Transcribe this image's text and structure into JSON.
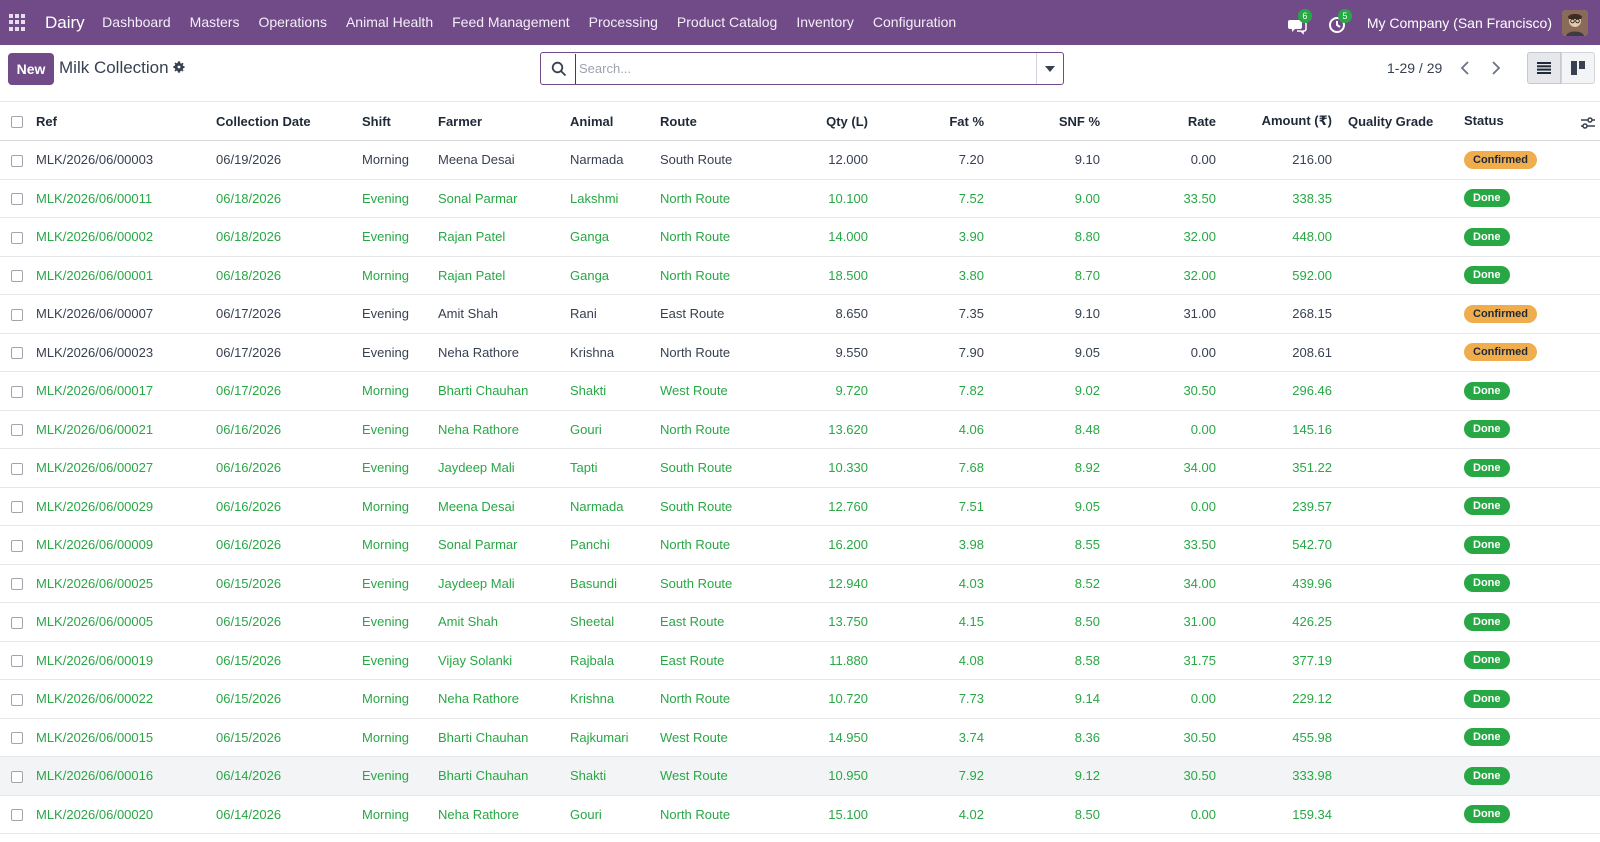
{
  "navbar": {
    "brand": "Dairy",
    "menu": [
      "Dashboard",
      "Masters",
      "Operations",
      "Animal Health",
      "Feed Management",
      "Processing",
      "Product Catalog",
      "Inventory",
      "Configuration"
    ],
    "messages_count": "6",
    "activities_count": "5",
    "company": "My Company (San Francisco)",
    "accent_color": "#714b88"
  },
  "control": {
    "new_label": "New",
    "title": "Milk Collection",
    "search_placeholder": "Search...",
    "pager": "1-29 / 29"
  },
  "table": {
    "headers": {
      "ref": "Ref",
      "date": "Collection Date",
      "shift": "Shift",
      "farmer": "Farmer",
      "animal": "Animal",
      "route": "Route",
      "qty": "Qty (L)",
      "fat": "Fat %",
      "snf": "SNF %",
      "rate": "Rate",
      "amount": "Amount (₹)",
      "grade": "Quality Grade",
      "status": "Status"
    },
    "rows": [
      {
        "ref": "MLK/2026/06/00003",
        "date": "06/19/2026",
        "shift": "Morning",
        "farmer": "Meena Desai",
        "animal": "Narmada",
        "route": "South Route",
        "qty": "12.000",
        "fat": "7.20",
        "snf": "9.10",
        "rate": "0.00",
        "amount": "216.00",
        "grade": "",
        "status": "Confirmed"
      },
      {
        "ref": "MLK/2026/06/00011",
        "date": "06/18/2026",
        "shift": "Evening",
        "farmer": "Sonal Parmar",
        "animal": "Lakshmi",
        "route": "North Route",
        "qty": "10.100",
        "fat": "7.52",
        "snf": "9.00",
        "rate": "33.50",
        "amount": "338.35",
        "grade": "",
        "status": "Done"
      },
      {
        "ref": "MLK/2026/06/00002",
        "date": "06/18/2026",
        "shift": "Evening",
        "farmer": "Rajan Patel",
        "animal": "Ganga",
        "route": "North Route",
        "qty": "14.000",
        "fat": "3.90",
        "snf": "8.80",
        "rate": "32.00",
        "amount": "448.00",
        "grade": "",
        "status": "Done"
      },
      {
        "ref": "MLK/2026/06/00001",
        "date": "06/18/2026",
        "shift": "Morning",
        "farmer": "Rajan Patel",
        "animal": "Ganga",
        "route": "North Route",
        "qty": "18.500",
        "fat": "3.80",
        "snf": "8.70",
        "rate": "32.00",
        "amount": "592.00",
        "grade": "",
        "status": "Done"
      },
      {
        "ref": "MLK/2026/06/00007",
        "date": "06/17/2026",
        "shift": "Evening",
        "farmer": "Amit Shah",
        "animal": "Rani",
        "route": "East Route",
        "qty": "8.650",
        "fat": "7.35",
        "snf": "9.10",
        "rate": "31.00",
        "amount": "268.15",
        "grade": "",
        "status": "Confirmed"
      },
      {
        "ref": "MLK/2026/06/00023",
        "date": "06/17/2026",
        "shift": "Evening",
        "farmer": "Neha Rathore",
        "animal": "Krishna",
        "route": "North Route",
        "qty": "9.550",
        "fat": "7.90",
        "snf": "9.05",
        "rate": "0.00",
        "amount": "208.61",
        "grade": "",
        "status": "Confirmed"
      },
      {
        "ref": "MLK/2026/06/00017",
        "date": "06/17/2026",
        "shift": "Morning",
        "farmer": "Bharti Chauhan",
        "animal": "Shakti",
        "route": "West Route",
        "qty": "9.720",
        "fat": "7.82",
        "snf": "9.02",
        "rate": "30.50",
        "amount": "296.46",
        "grade": "",
        "status": "Done"
      },
      {
        "ref": "MLK/2026/06/00021",
        "date": "06/16/2026",
        "shift": "Evening",
        "farmer": "Neha Rathore",
        "animal": "Gouri",
        "route": "North Route",
        "qty": "13.620",
        "fat": "4.06",
        "snf": "8.48",
        "rate": "0.00",
        "amount": "145.16",
        "grade": "",
        "status": "Done"
      },
      {
        "ref": "MLK/2026/06/00027",
        "date": "06/16/2026",
        "shift": "Evening",
        "farmer": "Jaydeep Mali",
        "animal": "Tapti",
        "route": "South Route",
        "qty": "10.330",
        "fat": "7.68",
        "snf": "8.92",
        "rate": "34.00",
        "amount": "351.22",
        "grade": "",
        "status": "Done"
      },
      {
        "ref": "MLK/2026/06/00029",
        "date": "06/16/2026",
        "shift": "Morning",
        "farmer": "Meena Desai",
        "animal": "Narmada",
        "route": "South Route",
        "qty": "12.760",
        "fat": "7.51",
        "snf": "9.05",
        "rate": "0.00",
        "amount": "239.57",
        "grade": "",
        "status": "Done"
      },
      {
        "ref": "MLK/2026/06/00009",
        "date": "06/16/2026",
        "shift": "Morning",
        "farmer": "Sonal Parmar",
        "animal": "Panchi",
        "route": "North Route",
        "qty": "16.200",
        "fat": "3.98",
        "snf": "8.55",
        "rate": "33.50",
        "amount": "542.70",
        "grade": "",
        "status": "Done"
      },
      {
        "ref": "MLK/2026/06/00025",
        "date": "06/15/2026",
        "shift": "Evening",
        "farmer": "Jaydeep Mali",
        "animal": "Basundi",
        "route": "South Route",
        "qty": "12.940",
        "fat": "4.03",
        "snf": "8.52",
        "rate": "34.00",
        "amount": "439.96",
        "grade": "",
        "status": "Done"
      },
      {
        "ref": "MLK/2026/06/00005",
        "date": "06/15/2026",
        "shift": "Evening",
        "farmer": "Amit Shah",
        "animal": "Sheetal",
        "route": "East Route",
        "qty": "13.750",
        "fat": "4.15",
        "snf": "8.50",
        "rate": "31.00",
        "amount": "426.25",
        "grade": "",
        "status": "Done"
      },
      {
        "ref": "MLK/2026/06/00019",
        "date": "06/15/2026",
        "shift": "Evening",
        "farmer": "Vijay Solanki",
        "animal": "Rajbala",
        "route": "East Route",
        "qty": "11.880",
        "fat": "4.08",
        "snf": "8.58",
        "rate": "31.75",
        "amount": "377.19",
        "grade": "",
        "status": "Done"
      },
      {
        "ref": "MLK/2026/06/00022",
        "date": "06/15/2026",
        "shift": "Morning",
        "farmer": "Neha Rathore",
        "animal": "Krishna",
        "route": "North Route",
        "qty": "10.720",
        "fat": "7.73",
        "snf": "9.14",
        "rate": "0.00",
        "amount": "229.12",
        "grade": "",
        "status": "Done"
      },
      {
        "ref": "MLK/2026/06/00015",
        "date": "06/15/2026",
        "shift": "Morning",
        "farmer": "Bharti Chauhan",
        "animal": "Rajkumari",
        "route": "West Route",
        "qty": "14.950",
        "fat": "3.74",
        "snf": "8.36",
        "rate": "30.50",
        "amount": "455.98",
        "grade": "",
        "status": "Done"
      },
      {
        "ref": "MLK/2026/06/00016",
        "date": "06/14/2026",
        "shift": "Evening",
        "farmer": "Bharti Chauhan",
        "animal": "Shakti",
        "route": "West Route",
        "qty": "10.950",
        "fat": "7.92",
        "snf": "9.12",
        "rate": "30.50",
        "amount": "333.98",
        "grade": "",
        "status": "Done",
        "highlight": true
      },
      {
        "ref": "MLK/2026/06/00020",
        "date": "06/14/2026",
        "shift": "Morning",
        "farmer": "Neha Rathore",
        "animal": "Gouri",
        "route": "North Route",
        "qty": "15.100",
        "fat": "4.02",
        "snf": "8.50",
        "rate": "0.00",
        "amount": "159.34",
        "grade": "",
        "status": "Done"
      }
    ]
  },
  "colors": {
    "done_text": "#28a745",
    "done_badge": "#28a745",
    "confirmed_badge": "#f0ad4e"
  }
}
